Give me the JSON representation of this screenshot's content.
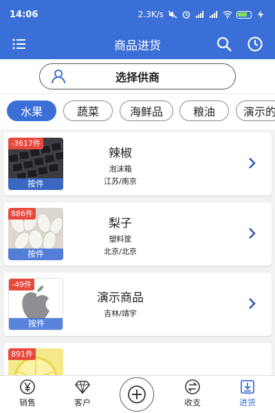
{
  "status": {
    "time": "14:06",
    "speed": "2.3K/s",
    "battery_color": "#7ee05a"
  },
  "nav": {
    "title": "商品进货"
  },
  "supplier": {
    "label": "选择供商"
  },
  "tabs": [
    {
      "label": "水果",
      "active": true
    },
    {
      "label": "蔬菜"
    },
    {
      "label": "海鲜品"
    },
    {
      "label": "粮油"
    },
    {
      "label": "演示的"
    }
  ],
  "products": [
    {
      "badge": "-3617件",
      "unit": "按件",
      "name": "辣椒",
      "pack": "泡沫箱",
      "origin": "江苏/南京",
      "image": "keyboard-photo"
    },
    {
      "badge": "886件",
      "unit": "按件",
      "name": "梨子",
      "pack": "塑料筐",
      "origin": "北京/北京",
      "image": "garlic-photo"
    },
    {
      "badge": "-49件",
      "unit": "按件",
      "name": "演示商品",
      "pack": "吉林/靖宇",
      "origin": "",
      "image": "apple-logo"
    },
    {
      "badge": "891件",
      "unit": "",
      "name": "",
      "pack": "",
      "origin": "",
      "image": "lemon-photo"
    }
  ],
  "bottom_nav": {
    "sales": "销售",
    "customers": "客户",
    "finance": "收支",
    "purchase": "进货"
  },
  "colors": {
    "primary": "#3b6fd8",
    "badge": "#e8473c"
  }
}
